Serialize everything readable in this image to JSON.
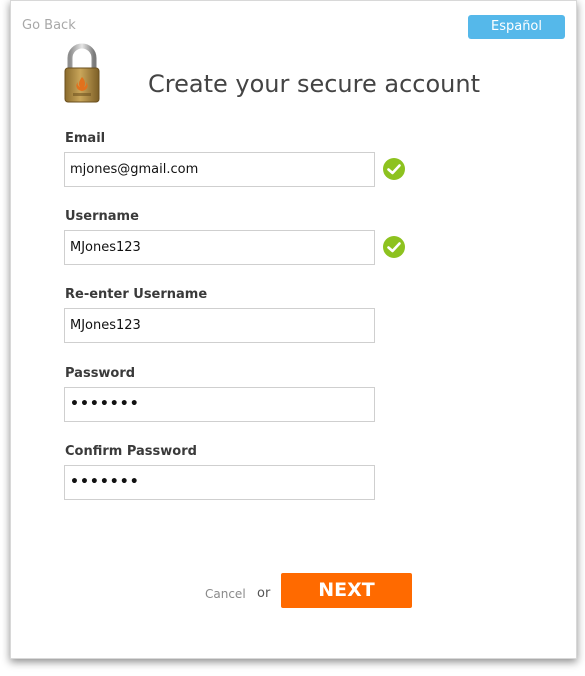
{
  "header": {
    "go_back_label": "Go Back",
    "language_label": "Español",
    "title": "Create your secure account"
  },
  "form": {
    "email": {
      "label": "Email",
      "value": "mjones@gmail.com",
      "valid": true
    },
    "username": {
      "label": "Username",
      "value": "MJones123",
      "valid": true
    },
    "reenter_username": {
      "label": "Re-enter Username",
      "value": "MJones123"
    },
    "password": {
      "label": "Password",
      "value": "•••••••"
    },
    "confirm_password": {
      "label": "Confirm Password",
      "value": "•••••••"
    }
  },
  "actions": {
    "cancel_label": "Cancel",
    "or_label": "or",
    "next_label": "NEXT"
  },
  "colors": {
    "accent_blue": "#55b8ea",
    "next_orange": "#ff6a00",
    "check_green": "#8dc21f",
    "lock_brass": "#b08a3e"
  },
  "icons": {
    "lock": "padlock-icon",
    "valid": "checkmark-icon"
  }
}
